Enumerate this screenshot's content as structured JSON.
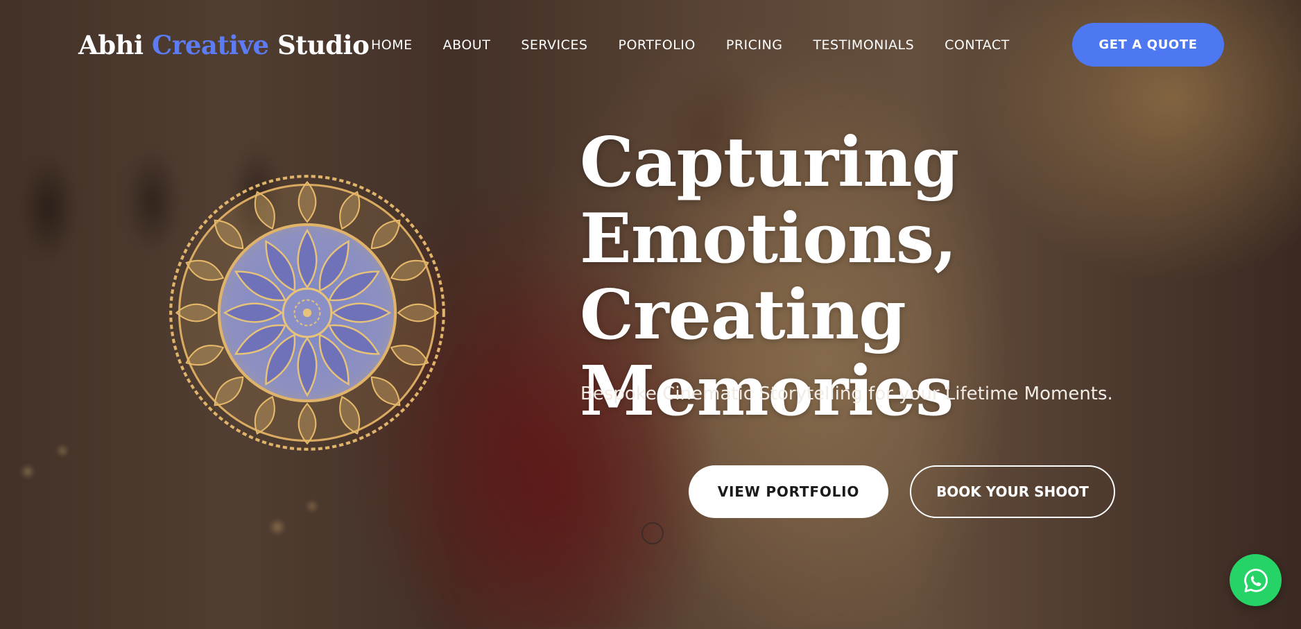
{
  "brand": {
    "name_part1": "Abhi ",
    "name_accent": "Creative",
    "name_part2": " Studio",
    "accent_color": "#5b7cf5"
  },
  "nav": {
    "items": [
      {
        "label": "HOME"
      },
      {
        "label": "ABOUT"
      },
      {
        "label": "SERVICES"
      },
      {
        "label": "PORTFOLIO"
      },
      {
        "label": "PRICING"
      },
      {
        "label": "TESTIMONIALS"
      },
      {
        "label": "CONTACT"
      }
    ]
  },
  "header": {
    "cta_label": "GET A QUOTE",
    "cta_color": "#4e78f2"
  },
  "hero": {
    "headline": "Capturing Emotions, Creating Memories",
    "subheadline": "Bespoke Cinematic Storytelling for your Lifetime Moments.",
    "primary_button": "VIEW PORTFOLIO",
    "secondary_button": "BOOK YOUR SHOOT",
    "decoration": "mandala-icon"
  },
  "floating": {
    "whatsapp_icon": "whatsapp-icon",
    "whatsapp_color": "#25d366"
  }
}
